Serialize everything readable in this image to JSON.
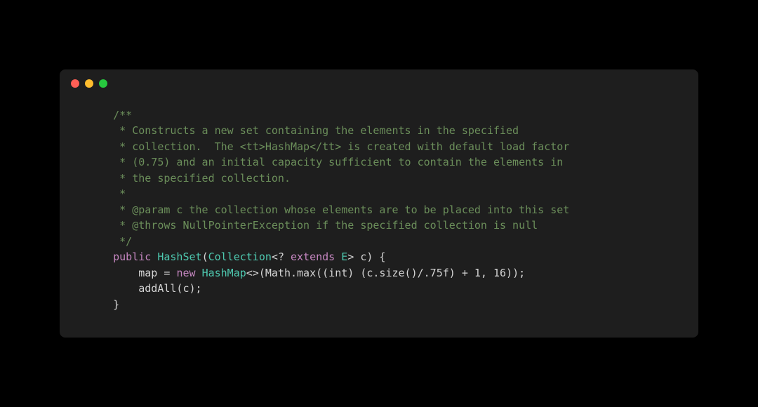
{
  "code": {
    "c1": "    /**",
    "c2": "     * Constructs a new set containing the elements in the specified",
    "c3": "     * collection.  The <tt>HashMap</tt> is created with default load factor",
    "c4": "     * (0.75) and an initial capacity sufficient to contain the elements in",
    "c5": "     * the specified collection.",
    "c6": "     *",
    "c7": "     * @param c the collection whose elements are to be placed into this set",
    "c8": "     * @throws NullPointerException if the specified collection is null",
    "c9": "     */",
    "indent1": "    ",
    "kw_public": "public",
    "sp": " ",
    "type_hashset": "HashSet",
    "lparen": "(",
    "type_collection": "Collection",
    "lt": "<",
    "q": "?",
    "kw_extends": "extends",
    "type_e": "E",
    "gt": ">",
    "param_c": " c",
    "rparen_brace": ") {",
    "indent2": "        ",
    "map_eq": "map = ",
    "kw_new": "new",
    "type_hashmap": "HashMap",
    "diamond": "<>",
    "math_expr": "(Math.max((int) (c.size()/.75f) + 1, 16));",
    "addall": "addAll(c);",
    "close_brace": "    }"
  }
}
